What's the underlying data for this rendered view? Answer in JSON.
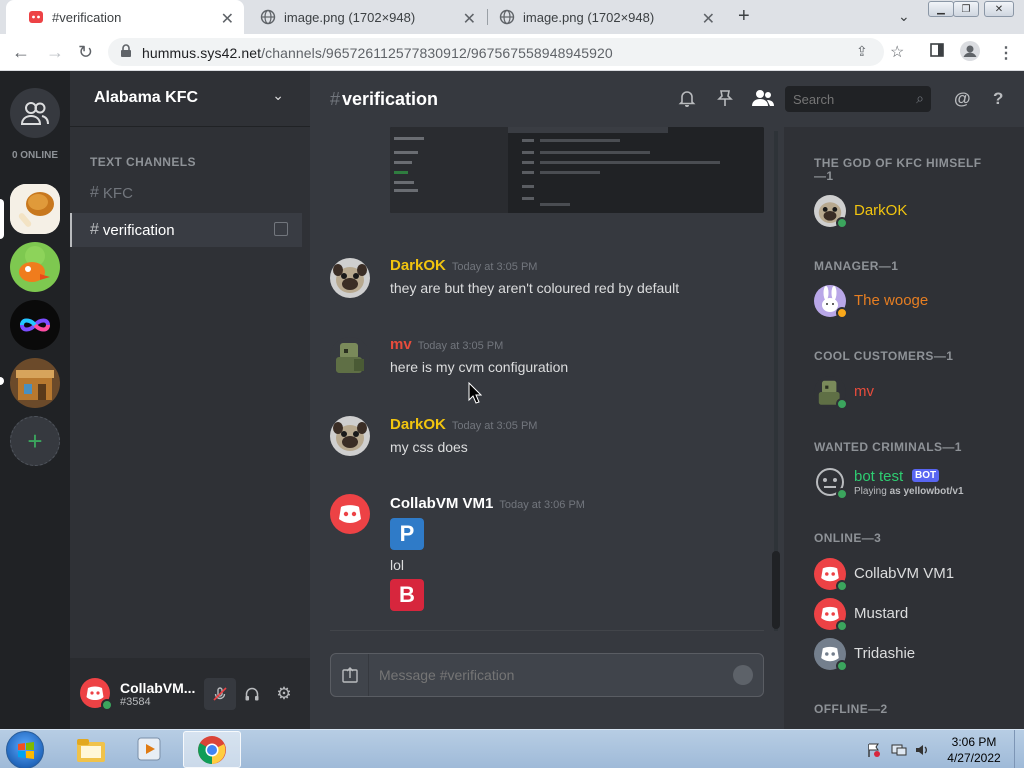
{
  "browser": {
    "tabs": [
      {
        "label": "#verification",
        "active": true
      },
      {
        "label": "image.png (1702×948)",
        "active": false
      },
      {
        "label": "image.png (1702×948)",
        "active": false
      }
    ],
    "url_host": "hummus.sys42.net",
    "url_path": "/channels/965726112577830912/967567558948945920"
  },
  "guilds": {
    "online_label": "0 ONLINE",
    "servers": [
      "KFC server",
      "Orange bird server",
      "Rainbow infinity server",
      "Shop server"
    ]
  },
  "server": {
    "name": "Alabama KFC",
    "category": "TEXT CHANNELS",
    "channels": [
      {
        "name": "KFC",
        "active": false
      },
      {
        "name": "verification",
        "active": true
      }
    ]
  },
  "user_panel": {
    "name": "CollabVM...",
    "tag": "#3584"
  },
  "chat": {
    "channel": "verification",
    "search_placeholder": "Search",
    "messages": [
      {
        "author": "DarkOK",
        "time": "Today at 3:05 PM",
        "text": "they are but they aren't coloured red by default",
        "color": "#f1c40f"
      },
      {
        "author": "mv",
        "time": "Today at 3:05 PM",
        "text": "here is my cvm configuration",
        "color": "#e74c3c"
      },
      {
        "author": "DarkOK",
        "time": "Today at 3:05 PM",
        "text": "my css does",
        "color": "#f1c40f"
      },
      {
        "author": "CollabVM VM1",
        "time": "Today at 3:06 PM",
        "text": "lol",
        "color": "#ffffff"
      }
    ],
    "reactions": [
      "P",
      "B"
    ],
    "input_placeholder": "Message #verification"
  },
  "members": {
    "groups": [
      {
        "title": "THE GOD OF KFC HIMSELF —1",
        "members": [
          {
            "name": "DarkOK",
            "color": "#f1c40f",
            "status": "online"
          }
        ]
      },
      {
        "title": "MANAGER—1",
        "members": [
          {
            "name": "The wooge",
            "color": "#e67e22",
            "status": "idle"
          }
        ]
      },
      {
        "title": "COOL CUSTOMERS—1",
        "members": [
          {
            "name": "mv",
            "color": "#e74c3c",
            "status": "online"
          }
        ]
      },
      {
        "title": "WANTED CRIMINALS—1",
        "members": [
          {
            "name": "bot test",
            "color": "#2ecc71",
            "status": "online",
            "bot_label": "BOT",
            "activity_prefix": "Playing",
            "activity": "as yellowbot/v1"
          }
        ]
      },
      {
        "title": "ONLINE—3",
        "members": [
          {
            "name": "CollabVM VM1",
            "color": "#dcddde",
            "status": "online"
          },
          {
            "name": "Mustard",
            "color": "#dcddde",
            "status": "online"
          },
          {
            "name": "Tridashie",
            "color": "#dcddde",
            "status": "online"
          }
        ]
      },
      {
        "title": "OFFLINE—2",
        "members": []
      }
    ]
  },
  "taskbar": {
    "time": "3:06 PM",
    "date": "4/27/2022"
  },
  "colors": {
    "online": "#3ba55d",
    "idle": "#faa81a",
    "discord_red": "#ed4245",
    "blurple": "#5865f2"
  }
}
